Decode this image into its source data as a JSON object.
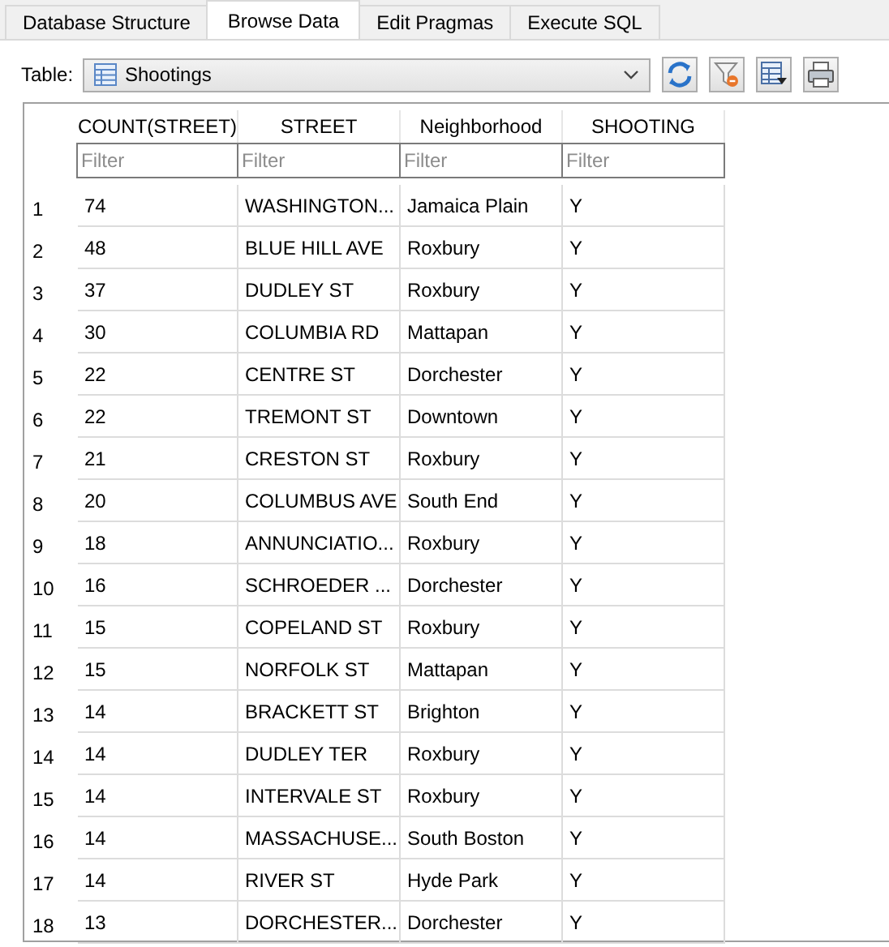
{
  "tabs": [
    {
      "label": "Database Structure",
      "selected": false
    },
    {
      "label": "Browse Data",
      "selected": true
    },
    {
      "label": "Edit Pragmas",
      "selected": false
    },
    {
      "label": "Execute SQL",
      "selected": false
    }
  ],
  "toolbar": {
    "table_label": "Table:",
    "table_value": "Shootings"
  },
  "table": {
    "columns": [
      {
        "label": "COUNT(STREET)",
        "filter_placeholder": "Filter"
      },
      {
        "label": "STREET",
        "filter_placeholder": "Filter"
      },
      {
        "label": "Neighborhood",
        "filter_placeholder": "Filter"
      },
      {
        "label": "SHOOTING",
        "filter_placeholder": "Filter"
      }
    ],
    "rows": [
      {
        "number": "1",
        "cells": [
          "74",
          "WASHINGTON...",
          "Jamaica Plain",
          "Y"
        ]
      },
      {
        "number": "2",
        "cells": [
          "48",
          "BLUE HILL AVE",
          "Roxbury",
          "Y"
        ]
      },
      {
        "number": "3",
        "cells": [
          "37",
          "DUDLEY ST",
          "Roxbury",
          "Y"
        ]
      },
      {
        "number": "4",
        "cells": [
          "30",
          "COLUMBIA RD",
          "Mattapan",
          "Y"
        ]
      },
      {
        "number": "5",
        "cells": [
          "22",
          "CENTRE ST",
          "Dorchester",
          "Y"
        ]
      },
      {
        "number": "6",
        "cells": [
          "22",
          "TREMONT ST",
          "Downtown",
          "Y"
        ]
      },
      {
        "number": "7",
        "cells": [
          "21",
          "CRESTON ST",
          "Roxbury",
          "Y"
        ]
      },
      {
        "number": "8",
        "cells": [
          "20",
          "COLUMBUS AVE",
          "South End",
          "Y"
        ]
      },
      {
        "number": "9",
        "cells": [
          "18",
          "ANNUNCIATIO...",
          "Roxbury",
          "Y"
        ]
      },
      {
        "number": "10",
        "cells": [
          "16",
          "SCHROEDER ...",
          "Dorchester",
          "Y"
        ]
      },
      {
        "number": "11",
        "cells": [
          "15",
          "COPELAND ST",
          "Roxbury",
          "Y"
        ]
      },
      {
        "number": "12",
        "cells": [
          "15",
          "NORFOLK ST",
          "Mattapan",
          "Y"
        ]
      },
      {
        "number": "13",
        "cells": [
          "14",
          "BRACKETT ST",
          "Brighton",
          "Y"
        ]
      },
      {
        "number": "14",
        "cells": [
          "14",
          "DUDLEY TER",
          "Roxbury",
          "Y"
        ]
      },
      {
        "number": "15",
        "cells": [
          "14",
          "INTERVALE ST",
          "Roxbury",
          "Y"
        ]
      },
      {
        "number": "16",
        "cells": [
          "14",
          "MASSACHUSE...",
          "South Boston",
          "Y"
        ]
      },
      {
        "number": "17",
        "cells": [
          "14",
          "RIVER ST",
          "Hyde Park",
          "Y"
        ]
      },
      {
        "number": "18",
        "cells": [
          "13",
          "DORCHESTER...",
          "Dorchester",
          "Y"
        ]
      }
    ]
  }
}
